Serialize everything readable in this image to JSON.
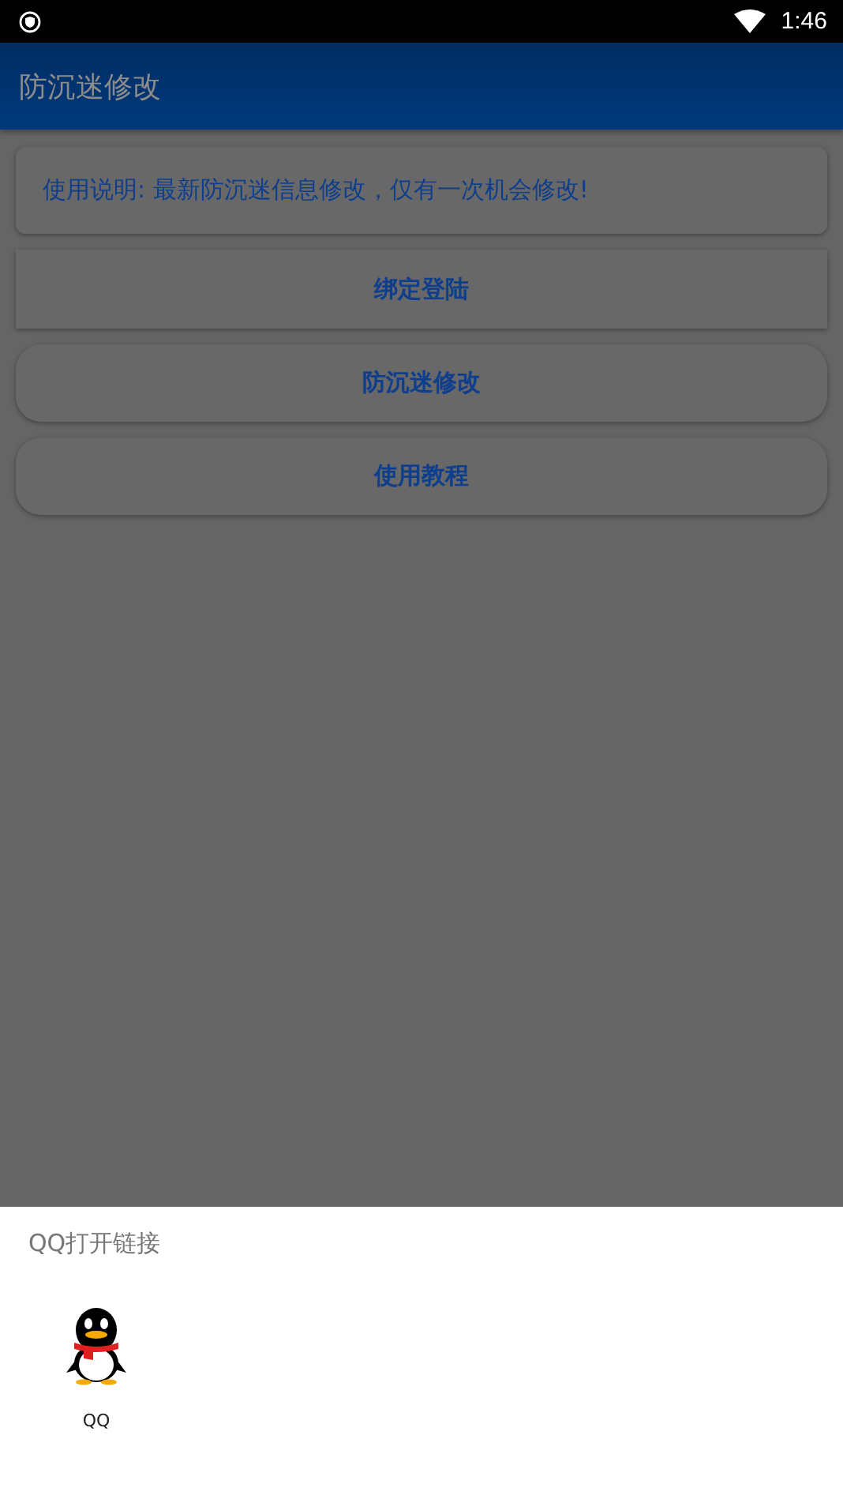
{
  "status_bar": {
    "time": "1:46"
  },
  "app_bar": {
    "title": "防沉迷修改"
  },
  "notice": {
    "text": "使用说明: 最新防沉迷信息修改，仅有一次机会修改!"
  },
  "buttons": [
    {
      "label": "绑定登陆",
      "kind": "square"
    },
    {
      "label": "防沉迷修改",
      "kind": "rounded"
    },
    {
      "label": "使用教程",
      "kind": "rounded"
    }
  ],
  "share_sheet": {
    "title": "QQ打开链接",
    "apps": [
      {
        "label": "QQ"
      }
    ]
  }
}
